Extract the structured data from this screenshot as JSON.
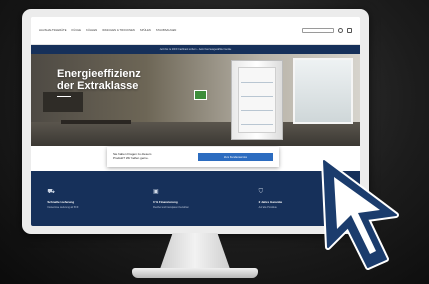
{
  "website": {
    "nav_items": [
      "HAUSHALTSGERÄTE",
      "KÜCHE",
      "KÜHLEN",
      "WASCHEN & TROCKNEN",
      "SPÜLEN",
      "STAUBSAUGEN"
    ],
    "search_placeholder": "Suche",
    "banner_text": "Jetzt bis zu 200 € Cashback sichern – beim Kauf ausgewählter Geräte",
    "hero": {
      "title_line1": "Energieeffizienz",
      "title_line2": "der Extraklasse"
    },
    "card": {
      "text": "Sie haben Fragen zu diesem Produkt? Wir helfen gerne.",
      "button_label": "Zum Kundenservice"
    },
    "features": [
      {
        "icon": "truck-icon",
        "title": "Schnelle Lieferung",
        "subtitle": "Kostenlose Lieferung ab 59 €"
      },
      {
        "icon": "finance-icon",
        "title": "0 % Finanzierung",
        "subtitle": "Flexibel und transparent bezahlen"
      },
      {
        "icon": "shield-icon",
        "title": "2 Jahre Garantie",
        "subtitle": "Auf alle Produkte"
      }
    ]
  },
  "colors": {
    "navy": "#16305a",
    "button_blue": "#2c6cc0",
    "cursor_blue": "#1b3c6d"
  }
}
